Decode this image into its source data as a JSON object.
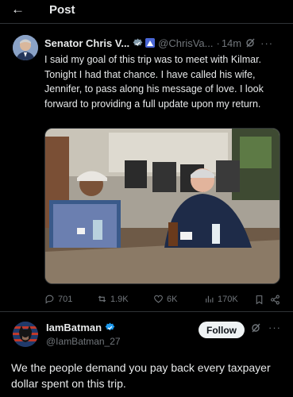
{
  "header": {
    "back_icon": "arrow-left-icon",
    "title": "Post"
  },
  "post": {
    "author_name": "Senator Chris V...",
    "handle": "@ChrisVa...",
    "separator": "·",
    "time": "14m",
    "text": "I said my goal of this trip was to meet with Kilmar. Tonight I had that chance. I have called his wife, Jennifer, to pass along his message of love. I look forward to providing a full update upon my return.",
    "stats": {
      "replies": "701",
      "reposts": "1.9K",
      "likes": "6K",
      "views": "170K"
    }
  },
  "reply": {
    "author_name": "IamBatman",
    "handle": "@IamBatman_27",
    "follow_label": "Follow",
    "text": "We the people demand you pay back every taxpayer dollar spent on this trip."
  },
  "colors": {
    "background": "#000000",
    "text": "#e7e9ea",
    "muted": "#71767b",
    "accent": "#1d9bf0",
    "divider": "#2f3336"
  }
}
